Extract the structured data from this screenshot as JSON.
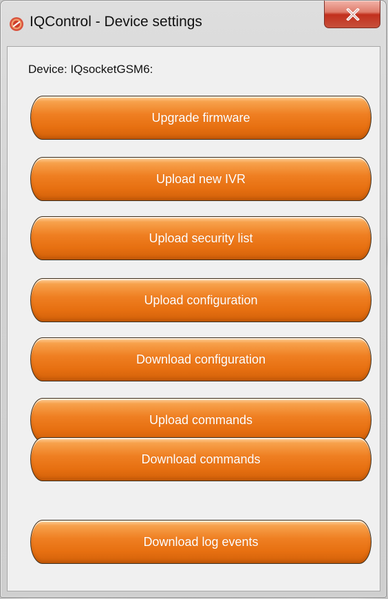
{
  "window": {
    "title": "IQControl - Device settings",
    "icon": "iqcontrol-app-icon",
    "close_label": "close"
  },
  "device": {
    "label": "Device: IQsocketGSM6:"
  },
  "actions": [
    {
      "label": "Upgrade firmware"
    },
    {
      "label": "Upload new IVR"
    },
    {
      "label": "Upload security list"
    },
    {
      "label": "Upload configuration"
    },
    {
      "label": "Download configuration"
    },
    {
      "label": "Upload commands"
    },
    {
      "label": "Download commands"
    },
    {
      "label": "Download log events"
    }
  ],
  "colors": {
    "accent": "#ef7f22",
    "close_button": "#c2301d",
    "dialog_background": "#f0f0f0"
  }
}
